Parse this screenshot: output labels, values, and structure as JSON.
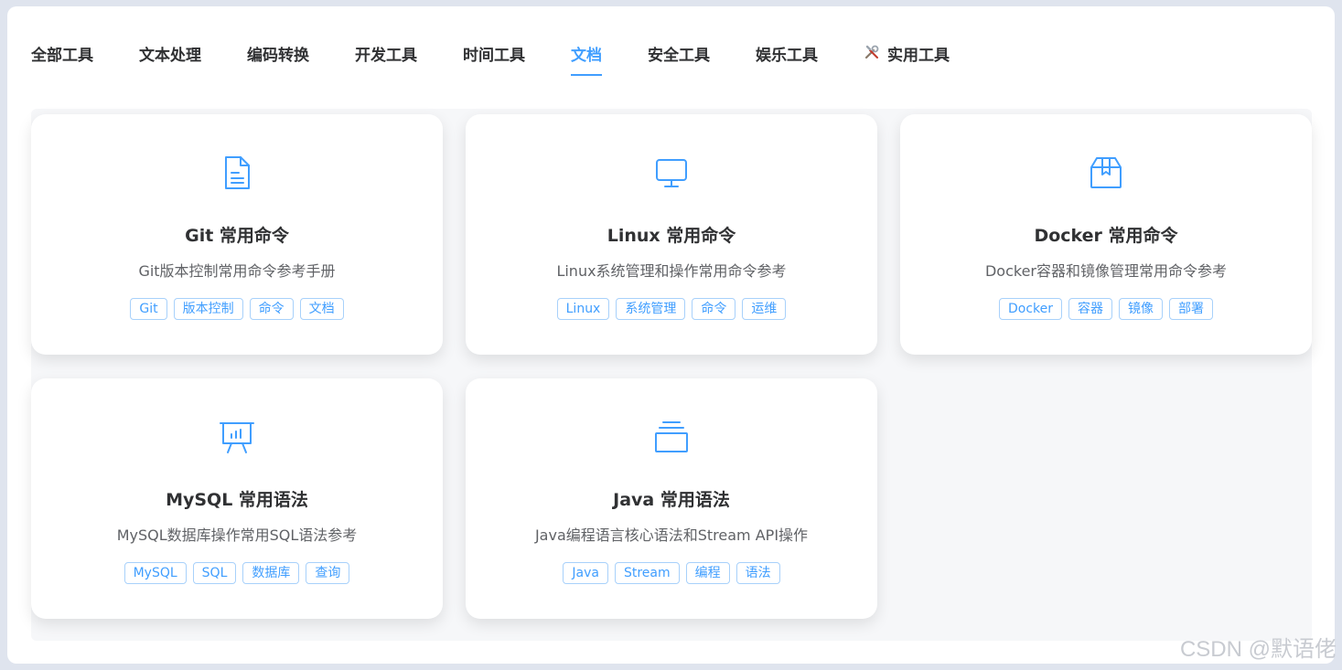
{
  "tabs": [
    {
      "label": "全部工具"
    },
    {
      "label": "文本处理"
    },
    {
      "label": "编码转换"
    },
    {
      "label": "开发工具"
    },
    {
      "label": "时间工具"
    },
    {
      "label": "文档",
      "active": true
    },
    {
      "label": "安全工具"
    },
    {
      "label": "娱乐工具"
    },
    {
      "label": "实用工具",
      "icon": "tools-icon"
    }
  ],
  "cards": [
    {
      "icon": "document-icon",
      "title": "Git 常用命令",
      "description": "Git版本控制常用命令参考手册",
      "tags": [
        "Git",
        "版本控制",
        "命令",
        "文档"
      ]
    },
    {
      "icon": "monitor-icon",
      "title": "Linux 常用命令",
      "description": "Linux系统管理和操作常用命令参考",
      "tags": [
        "Linux",
        "系统管理",
        "命令",
        "运维"
      ]
    },
    {
      "icon": "box-icon",
      "title": "Docker 常用命令",
      "description": "Docker容器和镜像管理常用命令参考",
      "tags": [
        "Docker",
        "容器",
        "镜像",
        "部署"
      ]
    },
    {
      "icon": "presentation-chart-icon",
      "title": "MySQL 常用语法",
      "description": "MySQL数据库操作常用SQL语法参考",
      "tags": [
        "MySQL",
        "SQL",
        "数据库",
        "查询"
      ]
    },
    {
      "icon": "stack-icon",
      "title": "Java 常用语法",
      "description": "Java编程语言核心语法和Stream API操作",
      "tags": [
        "Java",
        "Stream",
        "编程",
        "语法"
      ]
    }
  ],
  "watermark": "CSDN @默语佬",
  "colors": {
    "accent": "#409eff",
    "text": "#303133",
    "muted": "#606266"
  }
}
